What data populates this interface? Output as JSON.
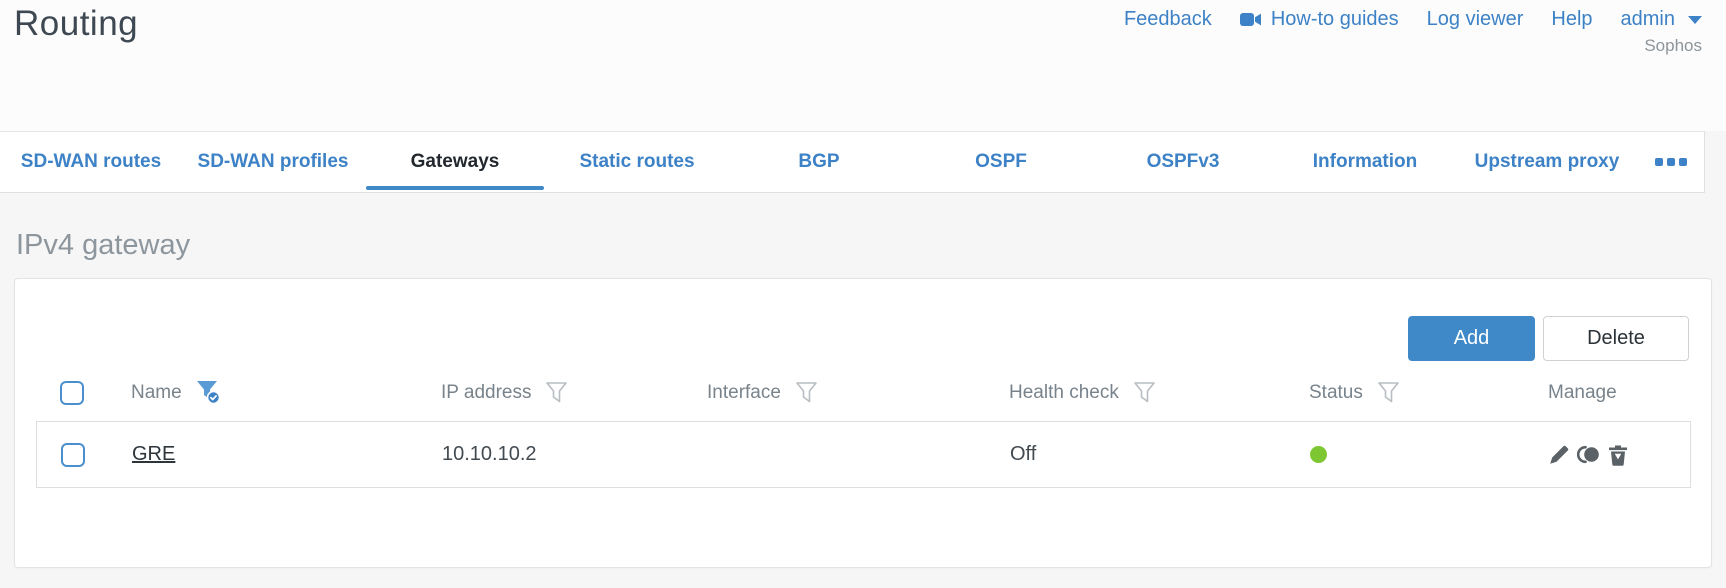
{
  "header": {
    "title": "Routing",
    "brand": "Sophos",
    "nav": {
      "feedback": "Feedback",
      "howto_guides": "How-to guides",
      "log_viewer": "Log viewer",
      "help": "Help",
      "user": "admin"
    }
  },
  "tabs": {
    "items": [
      {
        "label": "SD-WAN routes"
      },
      {
        "label": "SD-WAN profiles"
      },
      {
        "label": "Gateways"
      },
      {
        "label": "Static routes"
      },
      {
        "label": "BGP"
      },
      {
        "label": "OSPF"
      },
      {
        "label": "OSPFv3"
      },
      {
        "label": "Information"
      },
      {
        "label": "Upstream proxy"
      }
    ],
    "active": "Gateways",
    "more_icon": "ellipsis-icon"
  },
  "section": {
    "heading": "IPv4 gateway"
  },
  "toolbar": {
    "add_label": "Add",
    "delete_label": "Delete"
  },
  "table": {
    "columns": [
      {
        "label": "Name",
        "filter": "active"
      },
      {
        "label": "IP address",
        "filter": "inactive"
      },
      {
        "label": "Interface",
        "filter": "inactive"
      },
      {
        "label": "Health check",
        "filter": "inactive"
      },
      {
        "label": "Status",
        "filter": "inactive"
      },
      {
        "label": "Manage",
        "filter": "none"
      }
    ],
    "rows": [
      {
        "name": "GRE",
        "ip_address": "10.10.10.2",
        "interface": "",
        "health_check": "Off",
        "status": "up",
        "manage": [
          "edit-icon",
          "clone-icon",
          "delete-icon"
        ]
      }
    ]
  },
  "colors": {
    "accent": "#3d82c6",
    "button_blue": "#4089c9",
    "status_up": "#7dc832"
  }
}
